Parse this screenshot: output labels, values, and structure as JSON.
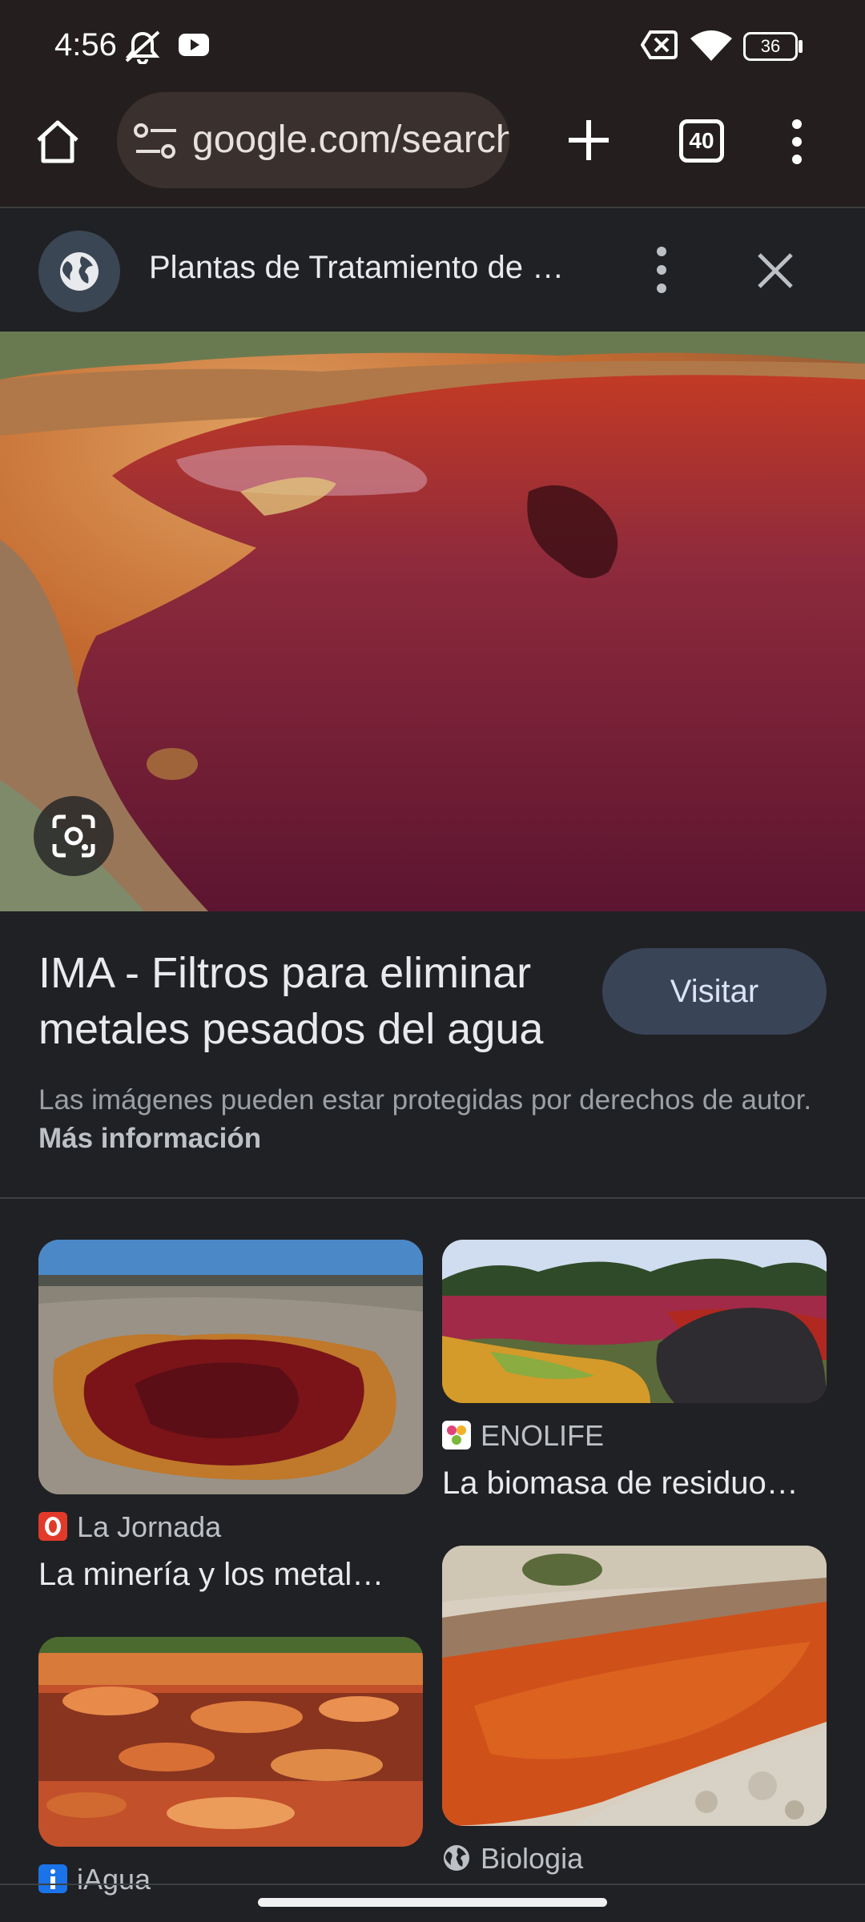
{
  "status_bar": {
    "time": "4:56",
    "battery": "36",
    "icons": [
      "mute-icon",
      "youtube-icon",
      "no-sim-icon",
      "wifi-icon",
      "battery-icon"
    ]
  },
  "toolbar": {
    "url": "google.com/search",
    "tab_count": "40",
    "icons": [
      "home-icon",
      "site-settings-icon",
      "new-tab-icon",
      "tab-switcher-icon",
      "overflow-menu-icon"
    ]
  },
  "panel": {
    "title": "Plantas de Tratamiento de …",
    "icons": [
      "globe-icon",
      "more-vert-icon",
      "close-icon"
    ]
  },
  "result": {
    "title": "IMA - Filtros para eliminar metales pesados del agua",
    "visit_label": "Visitar",
    "copyright_text": "Las imágenes pueden estar protegidas por derechos de autor.",
    "more_info_label": "Más información"
  },
  "related": [
    {
      "source": "La Jornada",
      "title": "La minería y los metal…"
    },
    {
      "source": "ENOLIFE",
      "title": "La biomasa de residuo…"
    },
    {
      "source": "iAgua",
      "title": ""
    },
    {
      "source": "Biologia",
      "title": ""
    }
  ],
  "colors": {
    "background": "#202124",
    "toolbar": "#241f1e",
    "visit_button": "#394457",
    "accent_red": "#8b1a1f"
  }
}
